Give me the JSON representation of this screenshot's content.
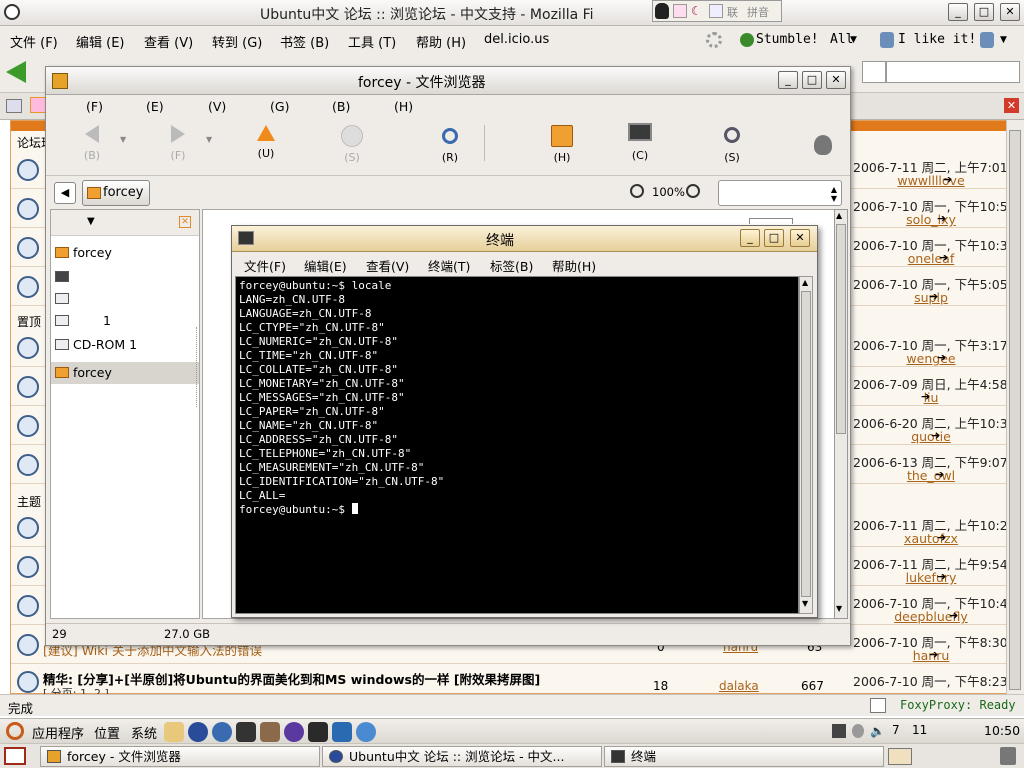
{
  "firefox": {
    "title": "Ubuntu中文 论坛 :: 浏览论坛 - 中文支持 - Mozilla Fi",
    "menu": [
      "文件 (F)",
      "编辑 (E)",
      "查看 (V)",
      "转到 (G)",
      "书签 (B)",
      "工具 (T)",
      "帮助 (H)",
      "del.icio.us"
    ],
    "stumble_label": "Stumble!",
    "all_label": "All",
    "ilike_label": "I like it!",
    "status_left": "完成",
    "status_right": "FoxyProxy: Ready",
    "left_fragments": {
      "forum_index": "论坛现",
      "sticky": "置顶",
      "topics": "主题"
    },
    "rows": [
      {
        "date": "2006-7-11 周二, 上午7:01",
        "user": "wwwllllove"
      },
      {
        "date": "2006-7-10 周一, 下午10:52",
        "user": "solo_lxy"
      },
      {
        "date": "2006-7-10 周一, 下午10:36",
        "user": "oneleaf"
      },
      {
        "date": "2006-7-10 周一, 下午5:05",
        "user": "suplp"
      },
      {
        "date": "2006-7-10 周一, 下午3:17",
        "user": "wengee"
      },
      {
        "date": "2006-7-09 周日, 上午4:58",
        "user": "liu"
      },
      {
        "date": "2006-6-20 周二, 上午10:32",
        "user": "quotie"
      },
      {
        "date": "2006-6-13 周二, 下午9:07",
        "user": "the_owl"
      },
      {
        "date": "2006-7-11 周二, 上午10:21",
        "user": "xautofzx"
      },
      {
        "date": "2006-7-11 周二, 上午9:54",
        "user": "lukefury"
      },
      {
        "date": "2006-7-10 周一, 下午10:40",
        "user": "deepbluefly"
      },
      {
        "date": "2006-7-10 周一, 下午8:30",
        "user": "hanru"
      },
      {
        "date": "2006-7-10 周一, 下午8:23",
        "user": "dalaka"
      }
    ],
    "bottom_topics": [
      {
        "title": "[建议] Wiki 关于添加中文输入法的错误",
        "replies": "0",
        "author": "hanru",
        "views": "63"
      },
      {
        "title": "精华: [分享]+[半原创]将Ubuntu的界面美化到和MS windows的一样 [附效果拷屏图]",
        "pages": "[ 分页: 1, 2 ]",
        "replies": "18",
        "author": "dalaka",
        "views": "667"
      }
    ]
  },
  "nautilus": {
    "title": "forcey - 文件浏览器",
    "menu": [
      "(F)",
      "(E)",
      "(V)",
      "(G)",
      "(B)",
      "(H)"
    ],
    "toolbar": {
      "back": "(B)",
      "forward": "(F)",
      "up": "(U)",
      "stop": "(S)",
      "reload": "(R)",
      "home": "(H)",
      "computer": "(C)",
      "search": "(S)"
    },
    "location_button": "forcey",
    "zoom": "100%",
    "sidebar": {
      "items": [
        {
          "label": "forcey"
        },
        {
          "label": ""
        },
        {
          "label": ""
        },
        {
          "label": "1"
        },
        {
          "label": "CD-ROM 1"
        },
        {
          "label": "forcey"
        }
      ]
    },
    "status": {
      "items": "29",
      "free": "27.0 GB"
    }
  },
  "terminal": {
    "title": "终端",
    "menu": [
      "文件(F)",
      "编辑(E)",
      "查看(V)",
      "终端(T)",
      "标签(B)",
      "帮助(H)"
    ],
    "lines": [
      "forcey@ubuntu:~$ locale",
      "LANG=zh_CN.UTF-8",
      "LANGUAGE=zh_CN.UTF-8",
      "LC_CTYPE=\"zh_CN.UTF-8\"",
      "LC_NUMERIC=\"zh_CN.UTF-8\"",
      "LC_TIME=\"zh_CN.UTF-8\"",
      "LC_COLLATE=\"zh_CN.UTF-8\"",
      "LC_MONETARY=\"zh_CN.UTF-8\"",
      "LC_MESSAGES=\"zh_CN.UTF-8\"",
      "LC_PAPER=\"zh_CN.UTF-8\"",
      "LC_NAME=\"zh_CN.UTF-8\"",
      "LC_ADDRESS=\"zh_CN.UTF-8\"",
      "LC_TELEPHONE=\"zh_CN.UTF-8\"",
      "LC_MEASUREMENT=\"zh_CN.UTF-8\"",
      "LC_IDENTIFICATION=\"zh_CN.UTF-8\"",
      "LC_ALL=",
      "forcey@ubuntu:~$ "
    ]
  },
  "ime": {
    "items": [
      "联",
      "拼音"
    ]
  },
  "panel": {
    "menus": [
      "应用程序",
      "位置",
      "系统"
    ],
    "tray_numbers": [
      "7",
      "11"
    ],
    "clock": "10:50",
    "tasks": [
      {
        "label": "forcey - 文件浏览器"
      },
      {
        "label": "Ubuntu中文 论坛 :: 浏览论坛 - 中文..."
      },
      {
        "label": "终端"
      }
    ]
  }
}
